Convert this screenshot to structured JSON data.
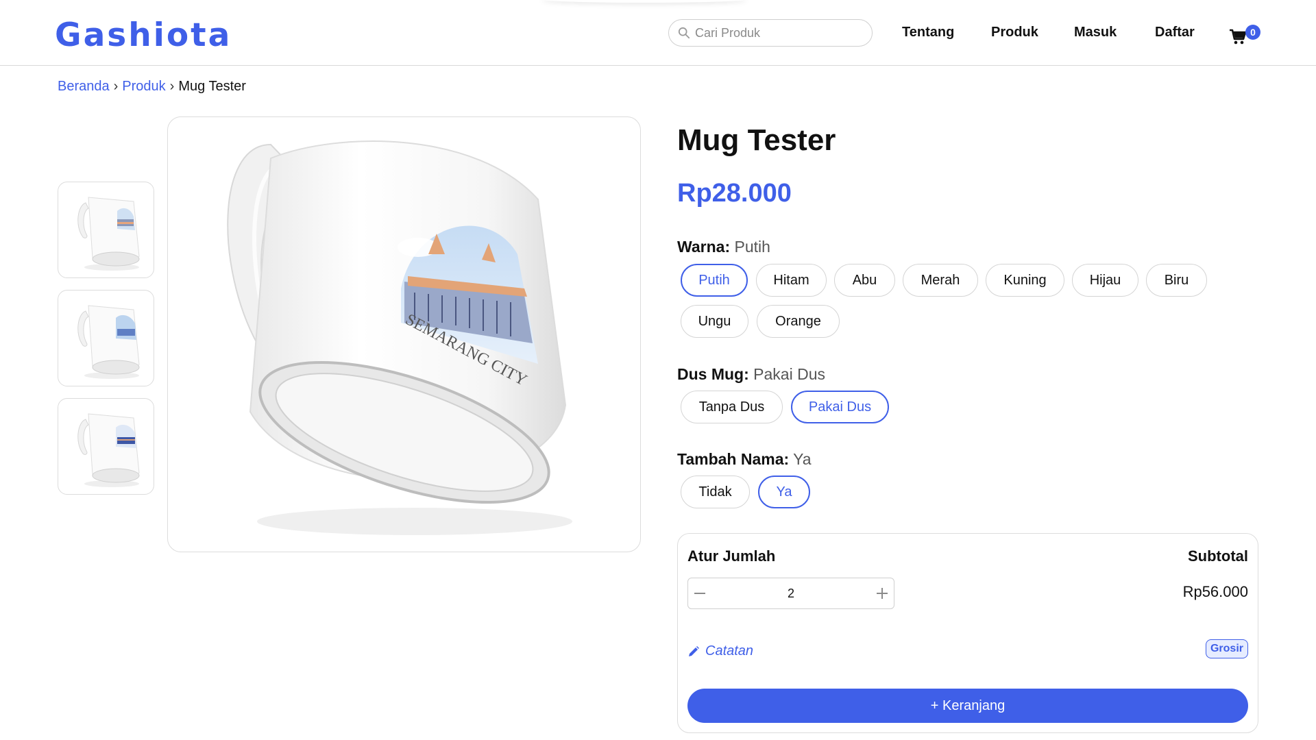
{
  "header": {
    "logo": "Gashiota",
    "search_placeholder": "Cari Produk",
    "nav": [
      "Tentang",
      "Produk",
      "Masuk",
      "Daftar"
    ],
    "cart_count": "0"
  },
  "breadcrumb": {
    "items": [
      "Beranda",
      "Produk"
    ],
    "separator": "›",
    "current": "Mug Tester"
  },
  "gallery": {
    "mug_text": "SEMARANG CITY"
  },
  "product": {
    "title": "Mug Tester",
    "price": "Rp28.000",
    "options": {
      "warna": {
        "label": "Warna:",
        "selected": "Putih",
        "choices": [
          "Putih",
          "Hitam",
          "Abu",
          "Merah",
          "Kuning",
          "Hijau",
          "Biru",
          "Ungu",
          "Orange"
        ]
      },
      "dus": {
        "label": "Dus Mug:",
        "selected": "Pakai Dus",
        "choices": [
          "Tanpa Dus",
          "Pakai Dus"
        ]
      },
      "nama": {
        "label": "Tambah Nama:",
        "selected": "Ya",
        "choices": [
          "Tidak",
          "Ya"
        ]
      }
    }
  },
  "purchase": {
    "quantity_heading": "Atur Jumlah",
    "subtotal_heading": "Subtotal",
    "quantity": "2",
    "subtotal": "Rp56.000",
    "note_label": "Catatan",
    "badge": "Grosir",
    "add_to_cart": "+ Keranjang"
  },
  "colors": {
    "accent": "#3f5fe8",
    "border": "#dcdcdc"
  }
}
